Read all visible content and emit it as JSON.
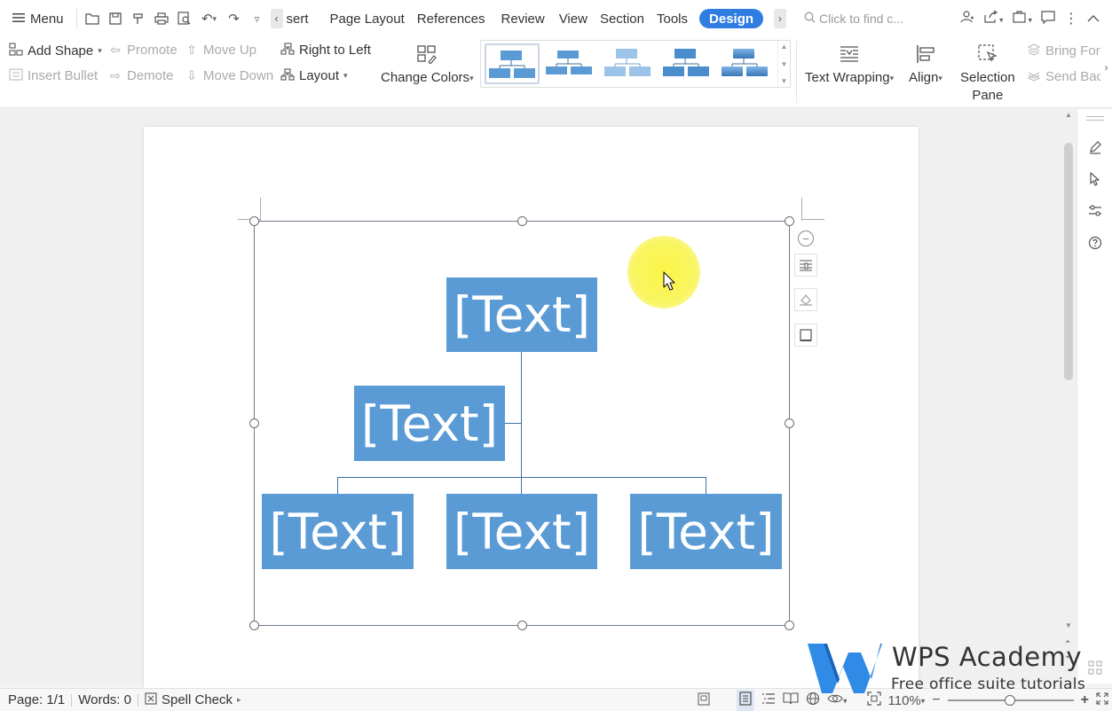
{
  "menu": {
    "label": "Menu"
  },
  "tabs": [
    {
      "label": "sert"
    },
    {
      "label": "Page Layout"
    },
    {
      "label": "References"
    },
    {
      "label": "Review"
    },
    {
      "label": "View"
    },
    {
      "label": "Section"
    },
    {
      "label": "Tools"
    },
    {
      "label": "Design"
    }
  ],
  "search": {
    "placeholder": "Click to find c..."
  },
  "ribbon": {
    "add_shape": "Add Shape",
    "insert_bullet": "Insert Bullet",
    "promote": "Promote",
    "demote": "Demote",
    "move_up": "Move Up",
    "move_down": "Move Down",
    "right_to_left": "Right to Left",
    "layout": "Layout",
    "change_colors": "Change Colors",
    "text_wrapping": "Text Wrapping",
    "align": "Align",
    "selection_pane_1": "Selection",
    "selection_pane_2": "Pane",
    "bring_forward": "Bring Fon",
    "send_backward": "Send Bacl"
  },
  "smartart": {
    "nodes": [
      "[Text]",
      "[Text]",
      "[Text]",
      "[Text]",
      "[Text]"
    ]
  },
  "status": {
    "page": "Page: 1/1",
    "words": "Words: 0",
    "spell_check": "Spell Check",
    "zoom": "110%"
  },
  "watermark": {
    "title": "WPS Academy",
    "subtitle": "Free office suite tutorials"
  },
  "colors": {
    "accent": "#2f7de1",
    "node_fill": "#5b9bd5",
    "connector": "#41719c",
    "highlight": "#f8f34a"
  }
}
